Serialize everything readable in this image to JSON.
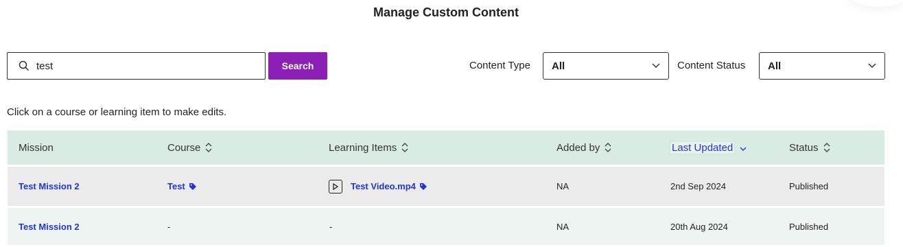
{
  "page": {
    "title": "Manage Custom Content"
  },
  "search": {
    "value": "test",
    "button_label": "Search"
  },
  "filters": {
    "content_type": {
      "label": "Content Type",
      "selected": "All"
    },
    "content_status": {
      "label": "Content Status",
      "selected": "All"
    }
  },
  "hint": "Click on a course or learning item to make edits.",
  "table": {
    "columns": [
      "Mission",
      "Course",
      "Learning Items",
      "Added by",
      "Last Updated",
      "Status"
    ],
    "rows": [
      {
        "mission": "Test Mission 2",
        "course": "Test",
        "learning_item": "Test Video.mp4",
        "added_by": "NA",
        "last_updated": "2nd Sep 2024",
        "status": "Published"
      },
      {
        "mission": "Test Mission 2",
        "course": "-",
        "learning_item": "-",
        "added_by": "NA",
        "last_updated": "20th Aug 2024",
        "status": "Published"
      }
    ]
  },
  "colors": {
    "accent": "#8b1fb6",
    "link": "#2233dd",
    "header_bg": "#d8ece4"
  }
}
